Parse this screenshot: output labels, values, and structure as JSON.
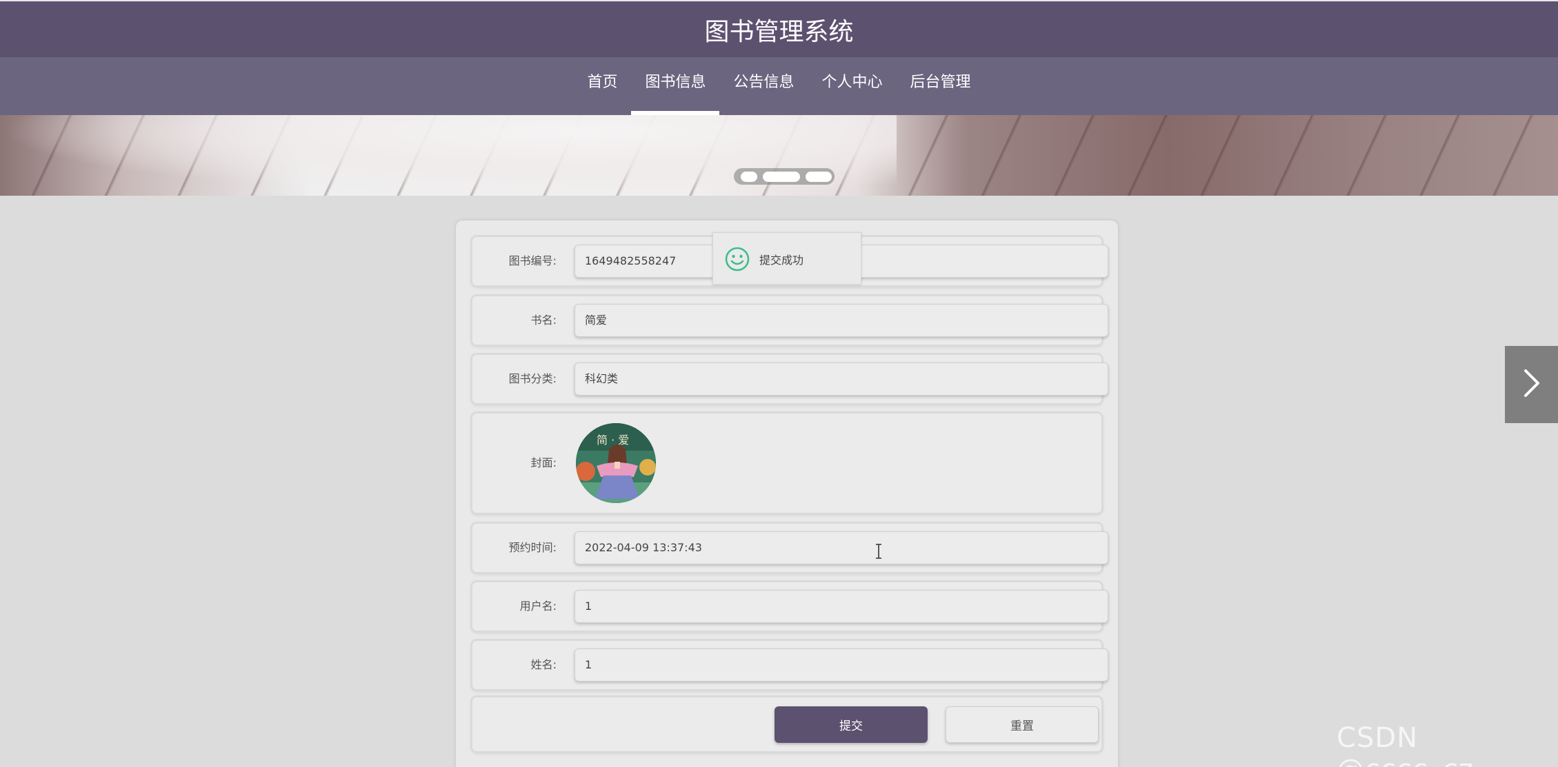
{
  "header": {
    "title": "图书管理系统"
  },
  "nav": {
    "items": [
      {
        "label": "首页"
      },
      {
        "label": "图书信息"
      },
      {
        "label": "公告信息"
      },
      {
        "label": "个人中心"
      },
      {
        "label": "后台管理"
      }
    ],
    "active_index": 1
  },
  "carousel": {
    "slide_count": 3,
    "active_index": 1
  },
  "form": {
    "fields": [
      {
        "label": "图书编号:",
        "value": "1649482558247"
      },
      {
        "label": "书名:",
        "value": "简爱"
      },
      {
        "label": "图书分类:",
        "value": "科幻类"
      },
      {
        "label": "封面:"
      },
      {
        "label": "预约时间:",
        "value": "2022-04-09 13:37:43"
      },
      {
        "label": "用户名:",
        "value": "1"
      },
      {
        "label": "姓名:",
        "value": "1"
      }
    ],
    "submit_label": "提交",
    "reset_label": "重置"
  },
  "toast": {
    "message": "提交成功"
  },
  "watermark": {
    "text": "CSDN @cccc_cz"
  },
  "colors": {
    "header_bg": "#5d5170",
    "nav_bg": "#6b6580",
    "page_bg": "#dcdcdc",
    "card_bg": "#e9e9e9",
    "primary_button": "#5d5170",
    "toast_icon": "#3ebc8c"
  },
  "icons": {
    "toast": "smile-icon",
    "next": "chevron-right-icon",
    "cursor": "text-cursor-icon"
  }
}
